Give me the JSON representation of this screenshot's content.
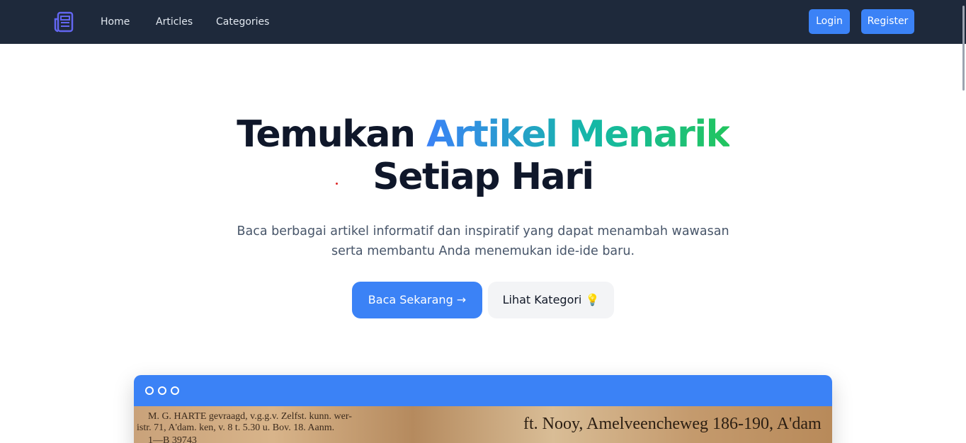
{
  "nav": {
    "links": [
      "Home",
      "Articles",
      "Categories"
    ],
    "login_label": "Login",
    "register_label": "Register",
    "logo_icon": "newspaper-icon"
  },
  "hero": {
    "title_part1": "Temukan ",
    "title_highlight": "Artikel Menarik",
    "title_line2": "Setiap Hari",
    "subtitle_line1": "Baca berbagai artikel informatif dan inspiratif yang dapat menambah wawasan",
    "subtitle_line2": "serta membantu Anda menemukan ide-ide baru.",
    "primary_button": "Baca Sekarang →",
    "secondary_button": "Lihat Kategori 💡"
  },
  "preview": {
    "paper_lines": [
      "M. G. HARTE  gevraagd, v.g.g.v. Zelfst. kunn. wer-",
      "istr. 71, A'dam.  ken, v. 8 t. 5.30 u. Bov. 18. Aanm.",
      "1—B 39743"
    ],
    "paper_big": "ft. Nooy, Amelveencheweg 186-190, A'dam"
  },
  "colors": {
    "navbar": "#1e293b",
    "accent": "#3b82f6",
    "gradient_start": "#3b82f6",
    "gradient_end": "#22c55e"
  }
}
